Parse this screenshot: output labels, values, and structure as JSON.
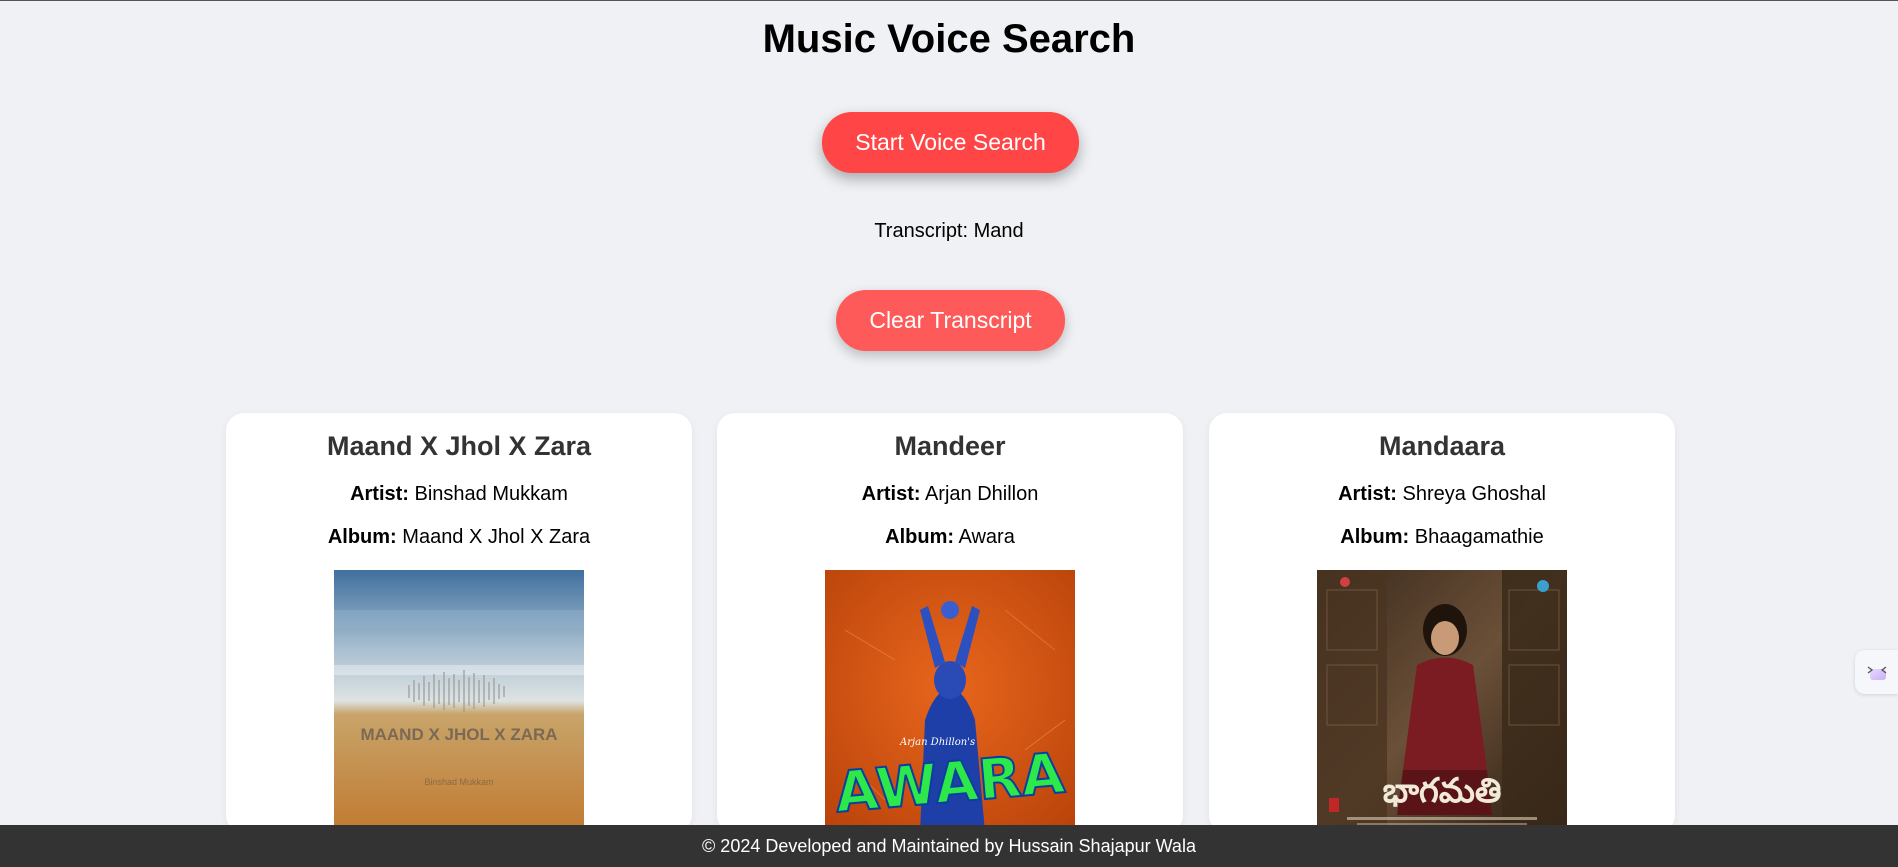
{
  "header": {
    "title": "Music Voice Search"
  },
  "controls": {
    "start_label": "Start Voice Search",
    "transcript_label": "Transcript:",
    "transcript_value": "Mand",
    "clear_label": "Clear Transcript"
  },
  "labels": {
    "artist": "Artist:",
    "album": "Album:"
  },
  "results": [
    {
      "title": "Maand X Jhol X Zara",
      "artist": "Binshad Mukkam",
      "album": "Maand X Jhol X Zara",
      "cover_text": "MAAND X JHOL X ZARA",
      "cover_subtext": "Binshad Mukkam"
    },
    {
      "title": "Mandeer",
      "artist": "Arjan Dhillon",
      "album": "Awara",
      "cover_text": "AWARA",
      "cover_subtext": "Arjan Dhillon's"
    },
    {
      "title": "Mandaara",
      "artist": "Shreya Ghoshal",
      "album": "Bhaagamathie",
      "cover_text": "భాగమతి",
      "cover_subtext": ""
    }
  ],
  "footer": {
    "text": "© 2024 Developed and Maintained by Hussain Shajapur Wala"
  },
  "colors": {
    "accent": "#ff4545",
    "accent_light": "#ff5a5a",
    "footer_bg": "#333333",
    "page_bg": "#eff1f5"
  }
}
